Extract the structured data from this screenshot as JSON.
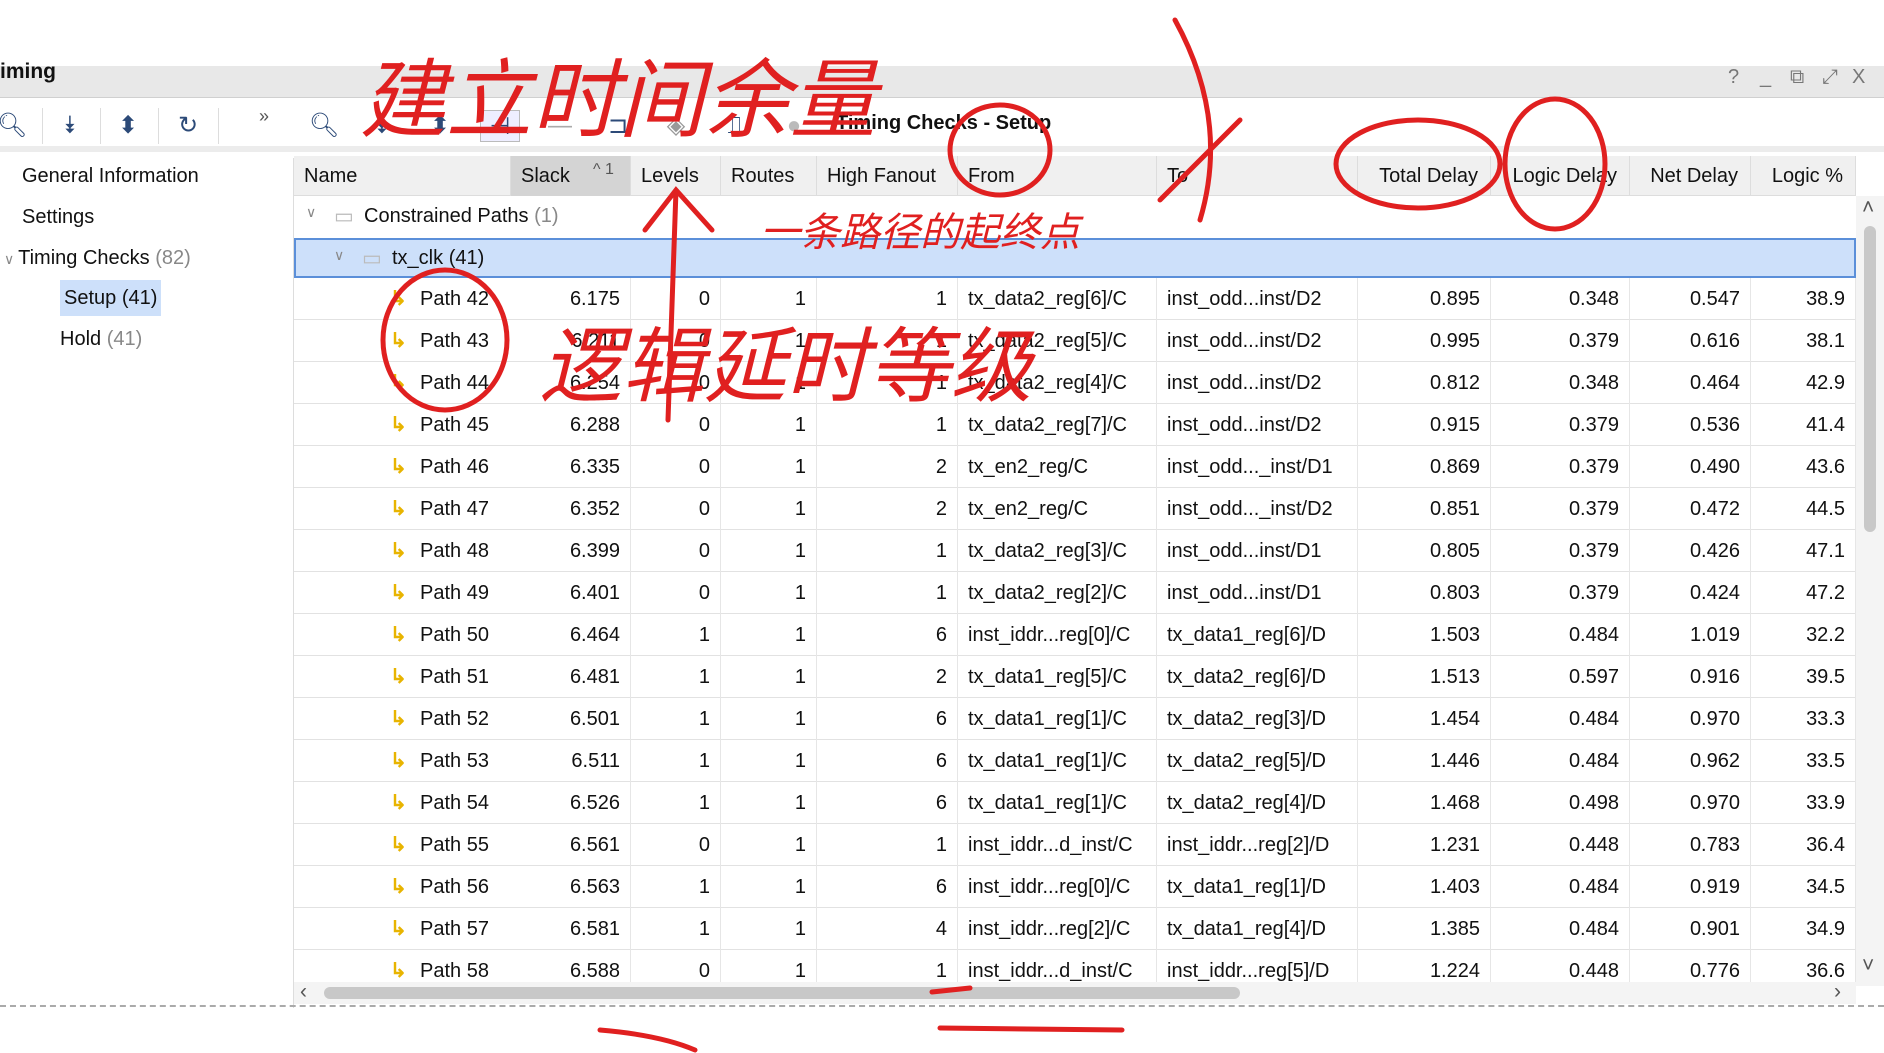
{
  "window": {
    "title": "iming",
    "buttons": [
      "?",
      "_",
      "⧉",
      "⤢",
      "X"
    ]
  },
  "left_toolbar": {
    "icons": [
      "search-icon",
      "collapse-all-icon",
      "expand-all-icon",
      "refresh-icon",
      "more-icon"
    ]
  },
  "right_toolbar": {
    "icons": [
      "search-icon",
      "collapse-all-icon",
      "expand-all-icon",
      "path-icon",
      "minus-icon",
      "schematic-icon",
      "diamond-icon",
      "waveform-icon",
      "info-icon"
    ],
    "title": "Timing Checks - Setup"
  },
  "sidebar": {
    "items": [
      {
        "label": "General Information",
        "count": ""
      },
      {
        "label": "Settings",
        "count": ""
      },
      {
        "label": "Timing Checks",
        "count": "(82)"
      },
      {
        "label": "Setup",
        "count": "(41)",
        "selected": true
      },
      {
        "label": "Hold",
        "count": "(41)"
      }
    ]
  },
  "table": {
    "columns": [
      "Name",
      "Slack",
      "Levels",
      "Routes",
      "High Fanout",
      "From",
      "To",
      "Total Delay",
      "Logic Delay",
      "Net Delay",
      "Logic %"
    ],
    "sort": {
      "column": "Slack",
      "indicator": "^",
      "order": "1"
    },
    "group": {
      "label": "Constrained Paths",
      "count": "(1)"
    },
    "clock": {
      "label": "tx_clk",
      "count": "(41)"
    },
    "rows": [
      [
        "Path 42",
        "6.175",
        "0",
        "1",
        "1",
        "tx_data2_reg[6]/C",
        "inst_odd...inst/D2",
        "0.895",
        "0.348",
        "0.547",
        "38.9"
      ],
      [
        "Path 43",
        "6.211",
        "0",
        "1",
        "1",
        "tx_data2_reg[5]/C",
        "inst_odd...inst/D2",
        "0.995",
        "0.379",
        "0.616",
        "38.1"
      ],
      [
        "Path 44",
        "6.254",
        "0",
        "1",
        "1",
        "tx_data2_reg[4]/C",
        "inst_odd...inst/D2",
        "0.812",
        "0.348",
        "0.464",
        "42.9"
      ],
      [
        "Path 45",
        "6.288",
        "0",
        "1",
        "1",
        "tx_data2_reg[7]/C",
        "inst_odd...inst/D2",
        "0.915",
        "0.379",
        "0.536",
        "41.4"
      ],
      [
        "Path 46",
        "6.335",
        "0",
        "1",
        "2",
        "tx_en2_reg/C",
        "inst_odd..._inst/D1",
        "0.869",
        "0.379",
        "0.490",
        "43.6"
      ],
      [
        "Path 47",
        "6.352",
        "0",
        "1",
        "2",
        "tx_en2_reg/C",
        "inst_odd..._inst/D2",
        "0.851",
        "0.379",
        "0.472",
        "44.5"
      ],
      [
        "Path 48",
        "6.399",
        "0",
        "1",
        "1",
        "tx_data2_reg[3]/C",
        "inst_odd...inst/D1",
        "0.805",
        "0.379",
        "0.426",
        "47.1"
      ],
      [
        "Path 49",
        "6.401",
        "0",
        "1",
        "1",
        "tx_data2_reg[2]/C",
        "inst_odd...inst/D1",
        "0.803",
        "0.379",
        "0.424",
        "47.2"
      ],
      [
        "Path 50",
        "6.464",
        "1",
        "1",
        "6",
        "inst_iddr...reg[0]/C",
        "tx_data1_reg[6]/D",
        "1.503",
        "0.484",
        "1.019",
        "32.2"
      ],
      [
        "Path 51",
        "6.481",
        "1",
        "1",
        "2",
        "tx_data1_reg[5]/C",
        "tx_data2_reg[6]/D",
        "1.513",
        "0.597",
        "0.916",
        "39.5"
      ],
      [
        "Path 52",
        "6.501",
        "1",
        "1",
        "6",
        "tx_data1_reg[1]/C",
        "tx_data2_reg[3]/D",
        "1.454",
        "0.484",
        "0.970",
        "33.3"
      ],
      [
        "Path 53",
        "6.511",
        "1",
        "1",
        "6",
        "tx_data1_reg[1]/C",
        "tx_data2_reg[5]/D",
        "1.446",
        "0.484",
        "0.962",
        "33.5"
      ],
      [
        "Path 54",
        "6.526",
        "1",
        "1",
        "6",
        "tx_data1_reg[1]/C",
        "tx_data2_reg[4]/D",
        "1.468",
        "0.498",
        "0.970",
        "33.9"
      ],
      [
        "Path 55",
        "6.561",
        "0",
        "1",
        "1",
        "inst_iddr...d_inst/C",
        "inst_iddr...reg[2]/D",
        "1.231",
        "0.448",
        "0.783",
        "36.4"
      ],
      [
        "Path 56",
        "6.563",
        "1",
        "1",
        "6",
        "inst_iddr...reg[0]/C",
        "tx_data1_reg[1]/D",
        "1.403",
        "0.484",
        "0.919",
        "34.5"
      ],
      [
        "Path 57",
        "6.581",
        "1",
        "1",
        "4",
        "inst_iddr...reg[2]/C",
        "tx_data1_reg[4]/D",
        "1.385",
        "0.484",
        "0.901",
        "34.9"
      ],
      [
        "Path 58",
        "6.588",
        "0",
        "1",
        "1",
        "inst_iddr...d_inst/C",
        "inst_iddr...reg[5]/D",
        "1.224",
        "0.448",
        "0.776",
        "36.6"
      ]
    ]
  },
  "annotations": {
    "slack_note": "建立时间余量",
    "levels_note": "逻辑延时等级",
    "from_to_note": "一条路径的起终点",
    "color": "#e02020"
  },
  "colors": {
    "selection": "#cde0fa",
    "selection_border": "#5b8fd9",
    "path_icon": "#e8b400",
    "icon_blue": "#2c4a78"
  }
}
